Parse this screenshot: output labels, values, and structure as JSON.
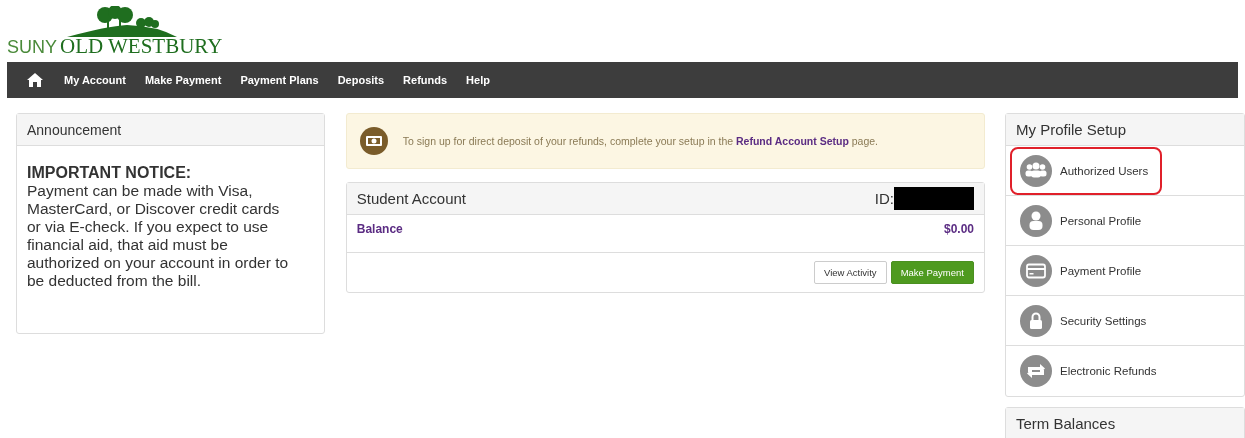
{
  "logo": {
    "prefix": "SUNY",
    "name": "OLD WESTBURY"
  },
  "nav": {
    "items": [
      "My Account",
      "Make Payment",
      "Payment Plans",
      "Deposits",
      "Refunds",
      "Help"
    ]
  },
  "announcement": {
    "title": "Announcement",
    "heading": "IMPORTANT NOTICE:",
    "body": "Payment can be made with Visa, MasterCard, or Discover credit cards or via E-check. If you expect to use financial aid, that aid must be authorized on your account in order to be deducted from the bill."
  },
  "notice": {
    "before": "To sign up for direct deposit of your refunds, complete your setup in the",
    "link": "Refund Account Setup",
    "after": "page."
  },
  "student_account": {
    "title": "Student Account",
    "id_label": "ID:",
    "id_redacted": true,
    "balance_label": "Balance",
    "balance": "$0.00",
    "buttons": [
      {
        "label": "View Activity",
        "kind": "default"
      },
      {
        "label": "Make Payment",
        "kind": "primary"
      }
    ]
  },
  "profile": {
    "title": "My Profile Setup",
    "items": [
      {
        "label": "Authorized Users",
        "kind": "users",
        "highlighted": true
      },
      {
        "label": "Personal Profile",
        "kind": "person",
        "highlighted": false
      },
      {
        "label": "Payment Profile",
        "kind": "card",
        "highlighted": false
      },
      {
        "label": "Security Settings",
        "kind": "lock",
        "highlighted": false
      },
      {
        "label": "Electronic Refunds",
        "kind": "refund",
        "highlighted": false
      }
    ]
  },
  "term_balances": {
    "title": "Term Balances"
  }
}
